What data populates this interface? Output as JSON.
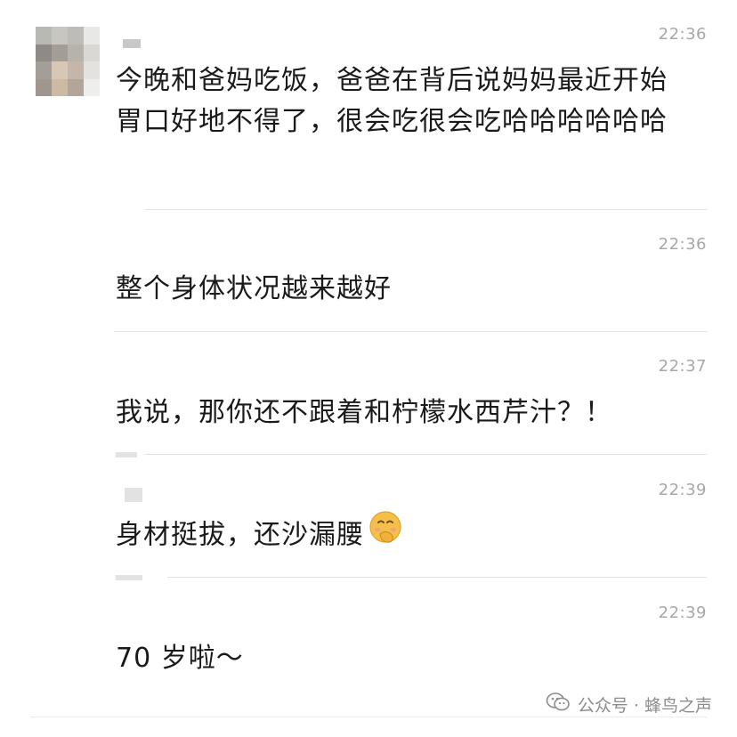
{
  "messages": [
    {
      "time": "22:36",
      "text": "今晚和爸妈吃饭，爸爸在背后说妈妈最近开始胃口好地不得了，很会吃很会吃哈哈哈哈哈哈"
    },
    {
      "time": "22:36",
      "text": "整个身体状况越来越好"
    },
    {
      "time": "22:37",
      "text": "我说，那你还不跟着和柠檬水西芹汁？！"
    },
    {
      "time": "22:39",
      "text": "身材挺拔，还沙漏腰",
      "emoji": "shy-smile-emoji"
    },
    {
      "time": "22:39",
      "text": "70 岁啦～"
    }
  ],
  "watermark": {
    "text": "公众号 · 蜂鸟之声",
    "icon": "wechat-icon"
  },
  "colors": {
    "text": "#1a1a1a",
    "time": "#a8a8a8",
    "divider": "#e2e2e2",
    "emoji": "#f5c04a"
  }
}
